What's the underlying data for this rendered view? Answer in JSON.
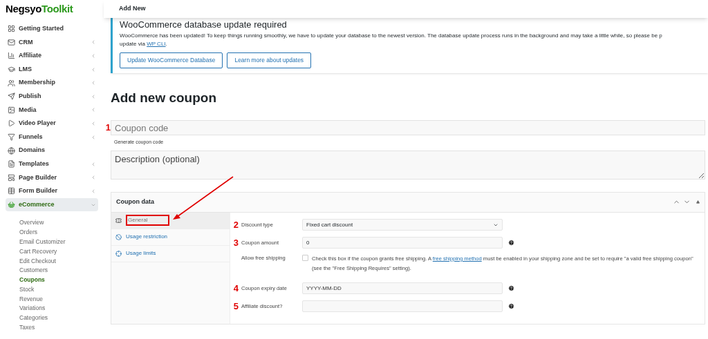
{
  "logo": {
    "part1": "Neg",
    "part2": "syo",
    "part3": "Toolkit"
  },
  "sidebar": {
    "items": [
      {
        "label": "Getting Started",
        "kind": "plain",
        "expanded": false
      },
      {
        "label": "CRM",
        "kind": "submenu",
        "expanded": false
      },
      {
        "label": "Affiliate",
        "kind": "submenu",
        "expanded": false
      },
      {
        "label": "LMS",
        "kind": "submenu",
        "expanded": false
      },
      {
        "label": "Membership",
        "kind": "submenu",
        "expanded": false
      },
      {
        "label": "Publish",
        "kind": "submenu",
        "expanded": false
      },
      {
        "label": "Media",
        "kind": "submenu",
        "expanded": false
      },
      {
        "label": "Video Player",
        "kind": "submenu",
        "expanded": false
      },
      {
        "label": "Funnels",
        "kind": "submenu",
        "expanded": false
      },
      {
        "label": "Domains",
        "kind": "plain",
        "expanded": false
      },
      {
        "label": "Templates",
        "kind": "submenu",
        "expanded": false
      },
      {
        "label": "Page Builder",
        "kind": "submenu",
        "expanded": false
      },
      {
        "label": "Form Builder",
        "kind": "submenu",
        "expanded": false
      },
      {
        "label": "eCommerce",
        "kind": "submenu",
        "expanded": true,
        "children": [
          {
            "label": "Overview",
            "selected": false
          },
          {
            "label": "Orders",
            "selected": false
          },
          {
            "label": "Email Customizer",
            "selected": false
          },
          {
            "label": "Cart Recovery",
            "selected": false
          },
          {
            "label": "Edit Checkout",
            "selected": false
          },
          {
            "label": "Customers",
            "selected": false
          },
          {
            "label": "Coupons",
            "selected": true
          },
          {
            "label": "Stock",
            "selected": false
          },
          {
            "label": "Revenue",
            "selected": false
          },
          {
            "label": "Variations",
            "selected": false
          },
          {
            "label": "Categories",
            "selected": false
          },
          {
            "label": "Taxes",
            "selected": false
          }
        ]
      }
    ]
  },
  "header": {
    "title": "Add New"
  },
  "notice": {
    "title": "WooCommerce database update required",
    "text_line1": "WooCommerce has been updated! To keep things running smoothly, we have to update your database to the newest version. The database update process runs in the background and may take a little while, so please be p",
    "text_line2": "update via",
    "link": "WP CLI",
    "text_end": ".",
    "buttons": [
      "Update WooCommerce Database",
      "Learn more about updates"
    ]
  },
  "page_title": "Add new coupon",
  "coupon_code": {
    "marker": "1",
    "placeholder": "Coupon code",
    "link": "Generate coupon code"
  },
  "description": {
    "placeholder": "Description (optional)"
  },
  "coupon_data": {
    "title": "Coupon data",
    "tabs": [
      {
        "label": "General",
        "selected": true
      },
      {
        "label": "Usage restriction",
        "selected": false
      },
      {
        "label": "Usage limits",
        "selected": false
      }
    ],
    "fields": [
      {
        "kind": "select",
        "marker": "2",
        "label": "Discount type",
        "value": "Fixed cart discount",
        "help": false
      },
      {
        "kind": "text",
        "marker": "3",
        "label": "Coupon amount",
        "value": "0",
        "help": true
      },
      {
        "kind": "checkbox",
        "label": "Allow free shipping",
        "checked": false,
        "text_before": "Check this box if the coupon grants free shipping. A",
        "link": "free shipping method",
        "text_after": "must be enabled in your shipping zone and be set to require \"a valid free shipping coupon\" (see the \"Free Shipping Requires\" setting).",
        "help": false
      },
      {
        "kind": "text",
        "marker": "4",
        "label": "Coupon expiry date",
        "placeholder": "YYYY-MM-DD",
        "help": true
      },
      {
        "kind": "text",
        "marker": "5",
        "label": "Affiliate discount?",
        "help": true
      }
    ]
  }
}
